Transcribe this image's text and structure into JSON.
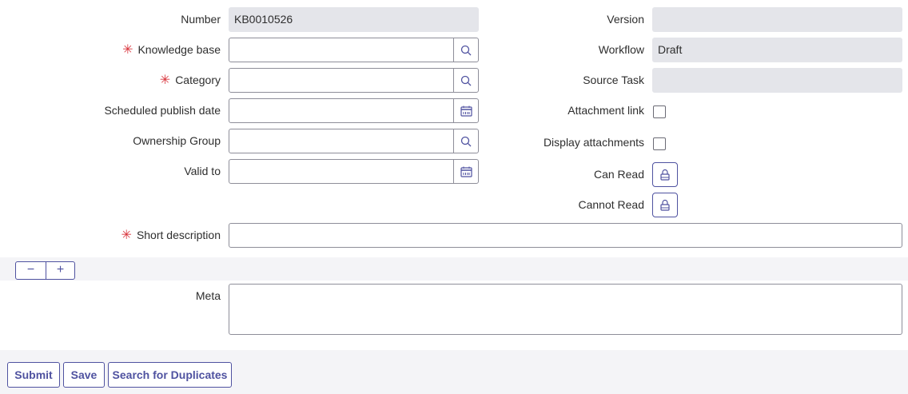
{
  "left_fields": [
    {
      "label": "Number",
      "value": "KB0010526",
      "required": false
    },
    {
      "label": "Knowledge base",
      "value": "",
      "required": true,
      "icon": "search"
    },
    {
      "label": "Category",
      "value": "",
      "required": true,
      "icon": "search"
    },
    {
      "label": "Scheduled publish date",
      "value": "",
      "required": false,
      "icon": "calendar"
    },
    {
      "label": "Ownership Group",
      "value": "",
      "required": false,
      "icon": "search"
    },
    {
      "label": "Valid to",
      "value": "",
      "required": false,
      "icon": "calendar"
    }
  ],
  "right_fields": {
    "version": {
      "label": "Version",
      "value": ""
    },
    "workflow": {
      "label": "Workflow",
      "value": "Draft"
    },
    "source_task": {
      "label": "Source Task",
      "value": ""
    },
    "attachment_link": {
      "label": "Attachment link",
      "checked": false
    },
    "display_attachments": {
      "label": "Display attachments",
      "checked": false
    },
    "can_read": {
      "label": "Can Read"
    },
    "cannot_read": {
      "label": "Cannot Read"
    }
  },
  "required_marker": "✳",
  "short_description": {
    "label": "Short description",
    "value": ""
  },
  "meta": {
    "label": "Meta",
    "value": ""
  },
  "zoom": {
    "minus": "−",
    "plus": "+"
  },
  "buttons": {
    "submit": "Submit",
    "save": "Save",
    "search_duplicates": "Search for Duplicates"
  }
}
